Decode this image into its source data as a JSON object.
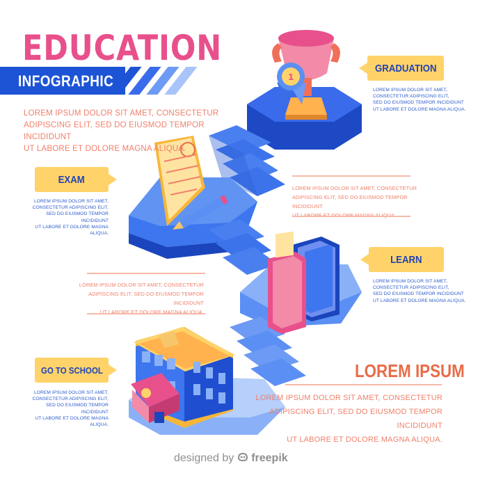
{
  "header": {
    "title": "EDUCATION",
    "subtitle": "INFOGRAPHIC"
  },
  "intro": {
    "line1": "LOREM IPSUM DOLOR SIT AMET, CONSECTETUR",
    "line2": "ADIPISCING ELIT, SED DO EIUSMOD TEMPOR INCIDIDUNT",
    "line3": "UT LABORE ET DOLORE MAGNA ALIQUA."
  },
  "steps": {
    "graduation": {
      "label": "GRADUATION",
      "line1": "LOREM IPSUM DOLOR SIT AMET,",
      "line2": "CONSECTETUR ADIPISCING ELIT,",
      "line3": "SED DO EIUSMOD TEMPOR INCIDIDUNT",
      "line4": "UT LABORE ET DOLORE MAGNA ALIQUA."
    },
    "exam": {
      "label": "EXAM",
      "line1": "LOREM IPSUM DOLOR SIT AMET,",
      "line2": "CONSECTETUR ADIPISCING ELIT,",
      "line3": "SED DO EIUSMOD TEMPOR INCIDIDUNT",
      "line4": "UT LABORE ET DOLORE MAGNA ALIQUA."
    },
    "learn": {
      "label": "LEARN",
      "line1": "LOREM IPSUM DOLOR SIT AMET,",
      "line2": "CONSECTETUR ADIPISCING ELIT,",
      "line3": "SED DO EIUSMOD TEMPOR INCIDIDUNT",
      "line4": "UT LABORE ET DOLORE MAGNA ALIQUA."
    },
    "school": {
      "label": "GO TO SCHOOL",
      "line1": "LOREM IPSUM DOLOR SIT AMET,",
      "line2": "CONSECTETUR ADIPISCING ELIT,",
      "line3": "SED DO EIUSMOD TEMPOR INCIDIDUNT",
      "line4": "UT LABORE ET DOLORE MAGNA ALIQUA."
    }
  },
  "mid_right": {
    "line1": "LOREM IPSUM DOLOR SIT AMET, CONSECTETUR",
    "line2": "ADIPISCING ELIT, SED DO EIUSMOD TEMPOR INCIDIDUNT",
    "line3": "UT LABORE ET DOLORE MAGNA ALIQUA."
  },
  "mid_left": {
    "line1": "LOREM IPSUM DOLOR SIT AMET, CONSECTETUR",
    "line2": "ADIPISCING ELIT, SED DO EIUSMOD TEMPOR INCIDIDUNT",
    "line3": "UT LABORE ET DOLORE MAGNA ALIQUA."
  },
  "footer_block": {
    "heading": "LOREM IPSUM",
    "line1": "LOREM IPSUM DOLOR SIT AMET, CONSECTETUR",
    "line2": "ADIPISCING ELIT, SED DO EIUSMOD TEMPOR INCIDIDUNT",
    "line3": "UT LABORE ET DOLORE MAGNA ALIQUA."
  },
  "credit": {
    "prefix": "designed by",
    "brand": "freepik"
  },
  "icons": [
    "trophy-icon",
    "medal-icon",
    "exam-paper-icon",
    "pencil-icon",
    "books-icon",
    "school-building-icon",
    "freepik-logo-icon"
  ],
  "colors": {
    "pink": "#e8508c",
    "blue": "#1d54d6",
    "light_blue": "#4f86ee",
    "yellow": "#ffd36a",
    "coral": "#f07f6a",
    "navy_text": "#2043b5"
  }
}
